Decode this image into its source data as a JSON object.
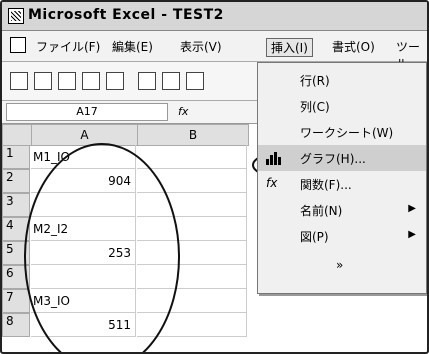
{
  "window": {
    "title": "Microsoft Excel - TEST2"
  },
  "menubar": {
    "items": [
      "ファイル(F)",
      "編集(E)",
      "表示(V)",
      "挿入(I)",
      "書式(O)",
      "ツール"
    ]
  },
  "formula_bar": {
    "namebox": "A17",
    "fx": "fx"
  },
  "sheet": {
    "columns": [
      "A",
      "B"
    ],
    "rows": [
      "1",
      "2",
      "3",
      "4",
      "5",
      "6",
      "7",
      "8"
    ],
    "cells": [
      "M1_IO",
      "904",
      "",
      "M2_I2",
      "253",
      "",
      "M3_IO",
      "511"
    ]
  },
  "insert_menu": {
    "items": [
      {
        "label": "行(R)",
        "icon": "",
        "submenu": false
      },
      {
        "label": "列(C)",
        "icon": "",
        "submenu": false
      },
      {
        "label": "ワークシート(W)",
        "icon": "",
        "submenu": false
      },
      {
        "label": "グラフ(H)...",
        "icon": "chart-icon",
        "submenu": false,
        "highlighted": true
      },
      {
        "label": "関数(F)...",
        "icon": "fx-icon",
        "submenu": false
      },
      {
        "label": "名前(N)",
        "icon": "",
        "submenu": true
      },
      {
        "label": "図(P)",
        "icon": "",
        "submenu": true
      }
    ],
    "more": "»"
  }
}
